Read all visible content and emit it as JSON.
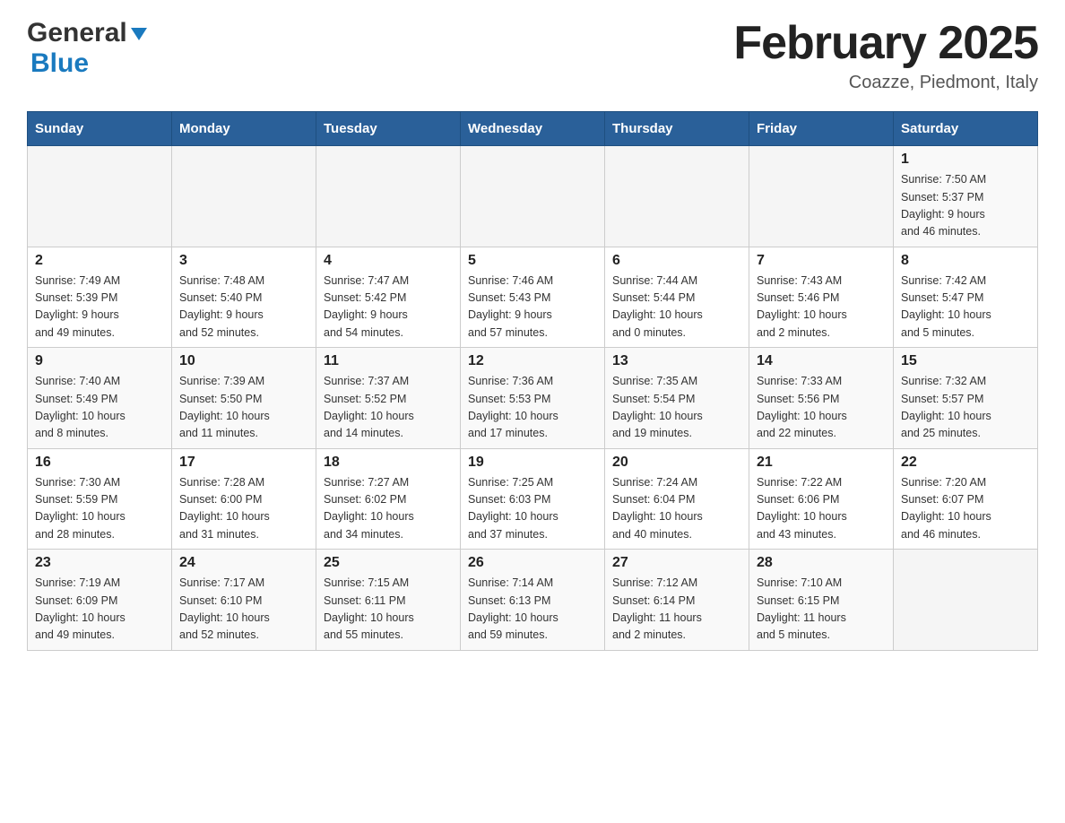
{
  "logo": {
    "general": "General",
    "blue": "Blue",
    "arrow": "▼"
  },
  "title": "February 2025",
  "subtitle": "Coazze, Piedmont, Italy",
  "weekdays": [
    "Sunday",
    "Monday",
    "Tuesday",
    "Wednesday",
    "Thursday",
    "Friday",
    "Saturday"
  ],
  "weeks": [
    [
      {
        "day": "",
        "info": ""
      },
      {
        "day": "",
        "info": ""
      },
      {
        "day": "",
        "info": ""
      },
      {
        "day": "",
        "info": ""
      },
      {
        "day": "",
        "info": ""
      },
      {
        "day": "",
        "info": ""
      },
      {
        "day": "1",
        "info": "Sunrise: 7:50 AM\nSunset: 5:37 PM\nDaylight: 9 hours\nand 46 minutes."
      }
    ],
    [
      {
        "day": "2",
        "info": "Sunrise: 7:49 AM\nSunset: 5:39 PM\nDaylight: 9 hours\nand 49 minutes."
      },
      {
        "day": "3",
        "info": "Sunrise: 7:48 AM\nSunset: 5:40 PM\nDaylight: 9 hours\nand 52 minutes."
      },
      {
        "day": "4",
        "info": "Sunrise: 7:47 AM\nSunset: 5:42 PM\nDaylight: 9 hours\nand 54 minutes."
      },
      {
        "day": "5",
        "info": "Sunrise: 7:46 AM\nSunset: 5:43 PM\nDaylight: 9 hours\nand 57 minutes."
      },
      {
        "day": "6",
        "info": "Sunrise: 7:44 AM\nSunset: 5:44 PM\nDaylight: 10 hours\nand 0 minutes."
      },
      {
        "day": "7",
        "info": "Sunrise: 7:43 AM\nSunset: 5:46 PM\nDaylight: 10 hours\nand 2 minutes."
      },
      {
        "day": "8",
        "info": "Sunrise: 7:42 AM\nSunset: 5:47 PM\nDaylight: 10 hours\nand 5 minutes."
      }
    ],
    [
      {
        "day": "9",
        "info": "Sunrise: 7:40 AM\nSunset: 5:49 PM\nDaylight: 10 hours\nand 8 minutes."
      },
      {
        "day": "10",
        "info": "Sunrise: 7:39 AM\nSunset: 5:50 PM\nDaylight: 10 hours\nand 11 minutes."
      },
      {
        "day": "11",
        "info": "Sunrise: 7:37 AM\nSunset: 5:52 PM\nDaylight: 10 hours\nand 14 minutes."
      },
      {
        "day": "12",
        "info": "Sunrise: 7:36 AM\nSunset: 5:53 PM\nDaylight: 10 hours\nand 17 minutes."
      },
      {
        "day": "13",
        "info": "Sunrise: 7:35 AM\nSunset: 5:54 PM\nDaylight: 10 hours\nand 19 minutes."
      },
      {
        "day": "14",
        "info": "Sunrise: 7:33 AM\nSunset: 5:56 PM\nDaylight: 10 hours\nand 22 minutes."
      },
      {
        "day": "15",
        "info": "Sunrise: 7:32 AM\nSunset: 5:57 PM\nDaylight: 10 hours\nand 25 minutes."
      }
    ],
    [
      {
        "day": "16",
        "info": "Sunrise: 7:30 AM\nSunset: 5:59 PM\nDaylight: 10 hours\nand 28 minutes."
      },
      {
        "day": "17",
        "info": "Sunrise: 7:28 AM\nSunset: 6:00 PM\nDaylight: 10 hours\nand 31 minutes."
      },
      {
        "day": "18",
        "info": "Sunrise: 7:27 AM\nSunset: 6:02 PM\nDaylight: 10 hours\nand 34 minutes."
      },
      {
        "day": "19",
        "info": "Sunrise: 7:25 AM\nSunset: 6:03 PM\nDaylight: 10 hours\nand 37 minutes."
      },
      {
        "day": "20",
        "info": "Sunrise: 7:24 AM\nSunset: 6:04 PM\nDaylight: 10 hours\nand 40 minutes."
      },
      {
        "day": "21",
        "info": "Sunrise: 7:22 AM\nSunset: 6:06 PM\nDaylight: 10 hours\nand 43 minutes."
      },
      {
        "day": "22",
        "info": "Sunrise: 7:20 AM\nSunset: 6:07 PM\nDaylight: 10 hours\nand 46 minutes."
      }
    ],
    [
      {
        "day": "23",
        "info": "Sunrise: 7:19 AM\nSunset: 6:09 PM\nDaylight: 10 hours\nand 49 minutes."
      },
      {
        "day": "24",
        "info": "Sunrise: 7:17 AM\nSunset: 6:10 PM\nDaylight: 10 hours\nand 52 minutes."
      },
      {
        "day": "25",
        "info": "Sunrise: 7:15 AM\nSunset: 6:11 PM\nDaylight: 10 hours\nand 55 minutes."
      },
      {
        "day": "26",
        "info": "Sunrise: 7:14 AM\nSunset: 6:13 PM\nDaylight: 10 hours\nand 59 minutes."
      },
      {
        "day": "27",
        "info": "Sunrise: 7:12 AM\nSunset: 6:14 PM\nDaylight: 11 hours\nand 2 minutes."
      },
      {
        "day": "28",
        "info": "Sunrise: 7:10 AM\nSunset: 6:15 PM\nDaylight: 11 hours\nand 5 minutes."
      },
      {
        "day": "",
        "info": ""
      }
    ]
  ]
}
